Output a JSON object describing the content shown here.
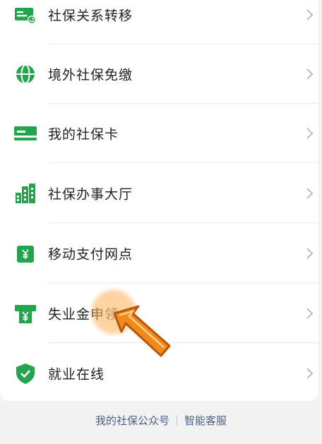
{
  "colors": {
    "accent": "#21a54d",
    "arrow": "#f08a1c"
  },
  "items": [
    {
      "label": "社保关系转移",
      "icon": "transfer-card-icon"
    },
    {
      "label": "境外社保免缴",
      "icon": "globe-icon"
    },
    {
      "label": "我的社保卡",
      "icon": "card-icon"
    },
    {
      "label": "社保办事大厅",
      "icon": "building-icon"
    },
    {
      "label": "移动支付网点",
      "icon": "wallet-yen-icon"
    },
    {
      "label": "失业金申领",
      "icon": "atm-yen-icon"
    },
    {
      "label": "就业在线",
      "icon": "shield-check-icon"
    }
  ],
  "footer": {
    "link_account": "我的社保公众号",
    "link_service": "智能客服"
  }
}
